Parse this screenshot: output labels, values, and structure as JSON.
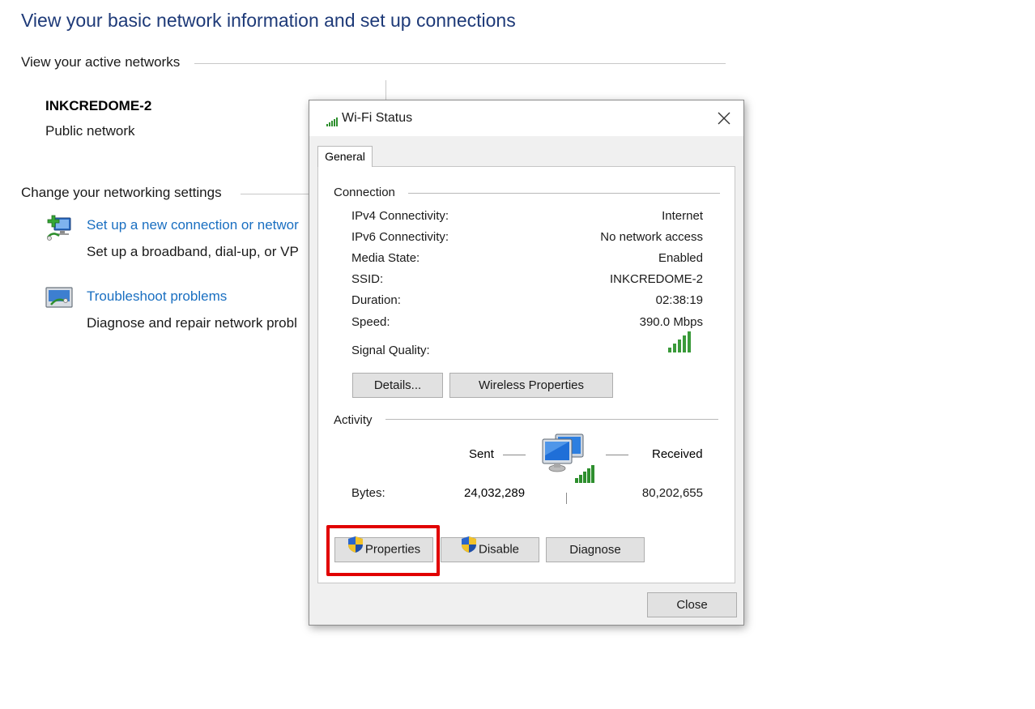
{
  "page": {
    "title": "View your basic network information and set up connections",
    "active_networks_heading": "View your active networks",
    "network_name": "INKCREDOME-2",
    "network_type": "Public network",
    "change_settings_heading": "Change your networking settings",
    "setup_link": "Set up a new connection or networ",
    "setup_desc": "Set up a broadband, dial-up, or VP",
    "troubleshoot_link": "Troubleshoot problems",
    "troubleshoot_desc": "Diagnose and repair network probl"
  },
  "dialog": {
    "title": "Wi-Fi Status",
    "tab": "General",
    "connection_label": "Connection",
    "rows": [
      {
        "label": "IPv4 Connectivity:",
        "value": "Internet"
      },
      {
        "label": "IPv6 Connectivity:",
        "value": "No network access"
      },
      {
        "label": "Media State:",
        "value": "Enabled"
      },
      {
        "label": "SSID:",
        "value": "INKCREDOME-2"
      },
      {
        "label": "Duration:",
        "value": "02:38:19"
      },
      {
        "label": "Speed:",
        "value": "390.0 Mbps"
      }
    ],
    "signal_label": "Signal Quality:",
    "signal_bars": 5,
    "details_button": "Details...",
    "wireless_props_button": "Wireless Properties",
    "activity_label": "Activity",
    "sent_label": "Sent",
    "received_label": "Received",
    "bytes_label": "Bytes:",
    "bytes_sent": "24,032,289",
    "bytes_received": "80,202,655",
    "properties_button": "Properties",
    "disable_button": "Disable",
    "diagnose_button": "Diagnose",
    "close_button": "Close"
  },
  "colors": {
    "title_blue": "#1e3a78",
    "link_blue": "#1a6fc1",
    "highlight_red": "#e10000",
    "signal_green": "#3a9a3a"
  },
  "icons": {
    "setup": "network-setup-icon",
    "troubleshoot": "troubleshoot-icon",
    "wifi": "wifi-signal-icon",
    "close": "close-icon",
    "shield": "uac-shield-icon",
    "computers": "network-computers-icon"
  }
}
